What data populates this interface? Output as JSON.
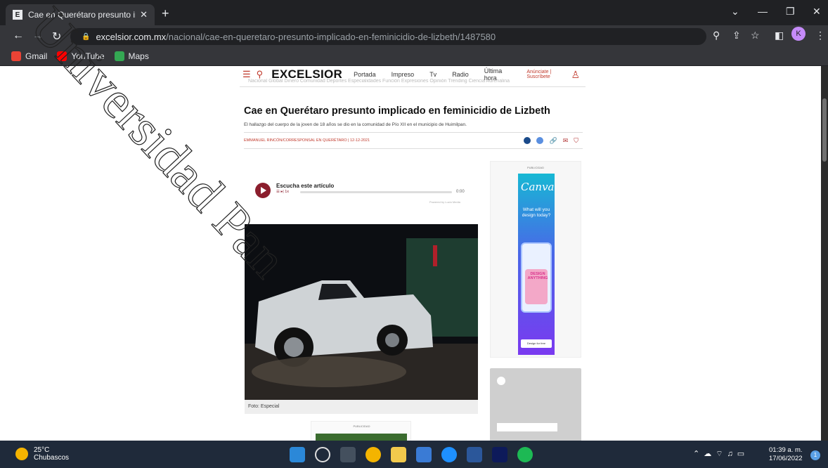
{
  "browser": {
    "tab_title": "Cae en Querétaro presunto impli",
    "tab_favicon": "E",
    "url_host": "excelsior.com.mx",
    "url_path": "/nacional/cae-en-queretaro-presunto-implicado-en-feminicidio-de-lizbeth/1487580",
    "profile_initial": "K",
    "bookmarks": [
      "Gmail",
      "YouTube",
      "Maps"
    ]
  },
  "site": {
    "logo": "EXCELSIOR",
    "nav": [
      "Portada",
      "Impreso",
      "Tv",
      "Radio",
      "Última hora"
    ],
    "account_links": "Anúnciate | Suscríbete",
    "subnav": "Nacional   Global   Dinero   Comunidad   Deportes   Especialidades   Función   Expresiones   Opinión   Trending   Ciencia   Adrenalina"
  },
  "article": {
    "headline": "Cae en Querétaro presunto implicado en feminicidio de Lizbeth",
    "summary": "El hallazgo del cuerpo de la joven de 18 años se dio en la comunidad de Pío XII en el municipio de Huimilpan.",
    "byline": "EMMANUEL RINCÓN/CORRESPONSAL EN QUERÉTARO | 12-12-2021",
    "photo_caption": "Foto: Especial"
  },
  "player": {
    "title": "Escucha este artículo",
    "speed": "1x",
    "time": "0:00",
    "powered": "Powered by Lucio Media",
    "progress": 0
  },
  "ads": {
    "label": "PUBLICIDAD",
    "canva_logo": "Canva",
    "canva_question": "What will you design today?",
    "canva_phone_text": "DESIGN ANYTHING",
    "canva_button": "Design for free"
  },
  "watermark": "Universidad Pan",
  "taskbar": {
    "temperature": "25°C",
    "weather": "Chubascos",
    "time": "01:39 a. m.",
    "date": "17/06/2022",
    "notifications": "1"
  }
}
